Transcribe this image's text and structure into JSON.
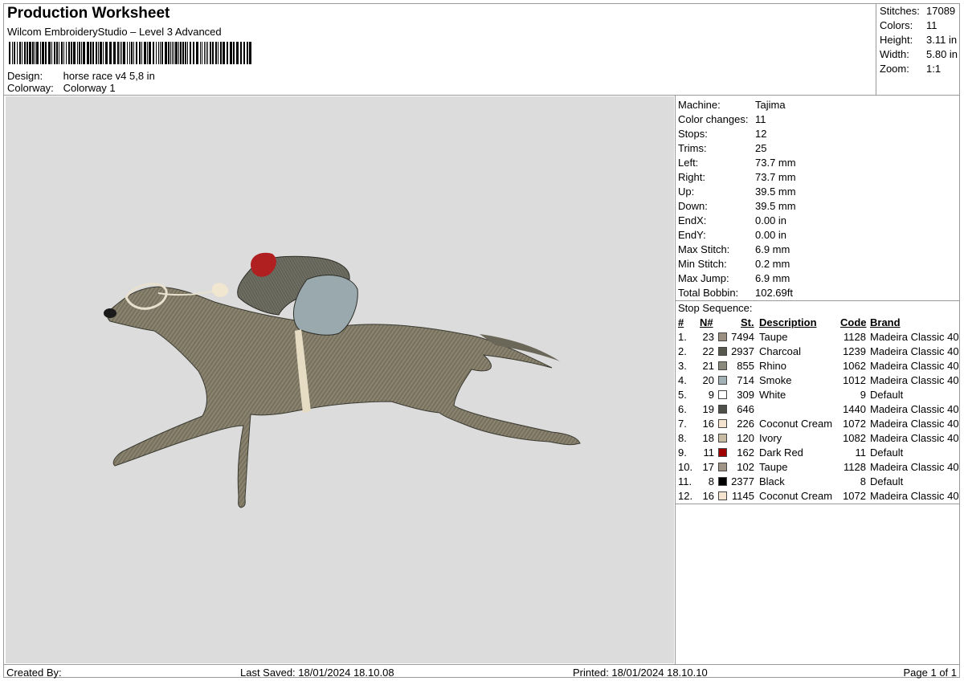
{
  "header": {
    "title": "Production Worksheet",
    "software": "Wilcom EmbroideryStudio – Level 3 Advanced",
    "design_label": "Design:",
    "design_value": "horse race v4 5,8 in",
    "colorway_label": "Colorway:",
    "colorway_value": "Colorway 1"
  },
  "summary": [
    {
      "label": "Stitches:",
      "value": "17089"
    },
    {
      "label": "Colors:",
      "value": "11"
    },
    {
      "label": "Height:",
      "value": "3.11 in"
    },
    {
      "label": "Width:",
      "value": "5.80 in"
    },
    {
      "label": "Zoom:",
      "value": "1:1"
    }
  ],
  "machine_info": [
    {
      "label": "Machine:",
      "value": "Tajima"
    },
    {
      "label": "Color changes:",
      "value": "11"
    },
    {
      "label": "Stops:",
      "value": "12"
    },
    {
      "label": "Trims:",
      "value": "25"
    },
    {
      "label": "Left:",
      "value": "73.7 mm"
    },
    {
      "label": "Right:",
      "value": "73.7 mm"
    },
    {
      "label": "Up:",
      "value": "39.5 mm"
    },
    {
      "label": "Down:",
      "value": "39.5 mm"
    },
    {
      "label": "EndX:",
      "value": "0.00 in"
    },
    {
      "label": "EndY:",
      "value": "0.00 in"
    },
    {
      "label": "Max Stitch:",
      "value": "6.9 mm"
    },
    {
      "label": "Min Stitch:",
      "value": "0.2 mm"
    },
    {
      "label": "Max Jump:",
      "value": "6.9 mm"
    },
    {
      "label": "Total Bobbin:",
      "value": "102.69ft"
    }
  ],
  "stop_sequence": {
    "title": "Stop Sequence:",
    "headers": {
      "num": "#",
      "n": "N#",
      "st": "St.",
      "desc": "Description",
      "code": "Code",
      "brand": "Brand"
    },
    "rows": [
      {
        "num": "1.",
        "n": "23",
        "color": "#9a8f80",
        "st": "7494",
        "desc": "Taupe",
        "code": "1128",
        "brand": "Madeira Classic 40"
      },
      {
        "num": "2.",
        "n": "22",
        "color": "#56584e",
        "st": "2937",
        "desc": "Charcoal",
        "code": "1239",
        "brand": "Madeira Classic 40"
      },
      {
        "num": "3.",
        "n": "21",
        "color": "#8a8a7c",
        "st": "855",
        "desc": "Rhino",
        "code": "1062",
        "brand": "Madeira Classic 40"
      },
      {
        "num": "4.",
        "n": "20",
        "color": "#a3b2b7",
        "st": "714",
        "desc": "Smoke",
        "code": "1012",
        "brand": "Madeira Classic 40"
      },
      {
        "num": "5.",
        "n": "9",
        "color": "#ffffff",
        "st": "309",
        "desc": "White",
        "code": "9",
        "brand": "Default"
      },
      {
        "num": "6.",
        "n": "19",
        "color": "#4c5049",
        "st": "646",
        "desc": "",
        "code": "1440",
        "brand": "Madeira Classic 40"
      },
      {
        "num": "7.",
        "n": "16",
        "color": "#f3e3cf",
        "st": "226",
        "desc": "Coconut Cream",
        "code": "1072",
        "brand": "Madeira Classic 40"
      },
      {
        "num": "8.",
        "n": "18",
        "color": "#c8bca4",
        "st": "120",
        "desc": "Ivory",
        "code": "1082",
        "brand": "Madeira Classic 40"
      },
      {
        "num": "9.",
        "n": "11",
        "color": "#a00000",
        "st": "162",
        "desc": "Dark Red",
        "code": "11",
        "brand": "Default"
      },
      {
        "num": "10.",
        "n": "17",
        "color": "#a09487",
        "st": "102",
        "desc": "Taupe",
        "code": "1128",
        "brand": "Madeira Classic 40"
      },
      {
        "num": "11.",
        "n": "8",
        "color": "#000000",
        "st": "2377",
        "desc": "Black",
        "code": "8",
        "brand": "Default"
      },
      {
        "num": "12.",
        "n": "16",
        "color": "#f3e3cf",
        "st": "1145",
        "desc": "Coconut Cream",
        "code": "1072",
        "brand": "Madeira Classic 40"
      }
    ]
  },
  "footer": {
    "created": "Created By:",
    "saved": "Last Saved: 18/01/2024 18.10.08",
    "printed": "Printed: 18/01/2024 18.10.10",
    "page": "Page 1 of 1"
  },
  "colors": {
    "canvas_bg": "#dcdcdc",
    "border": "#9a9a9a"
  }
}
